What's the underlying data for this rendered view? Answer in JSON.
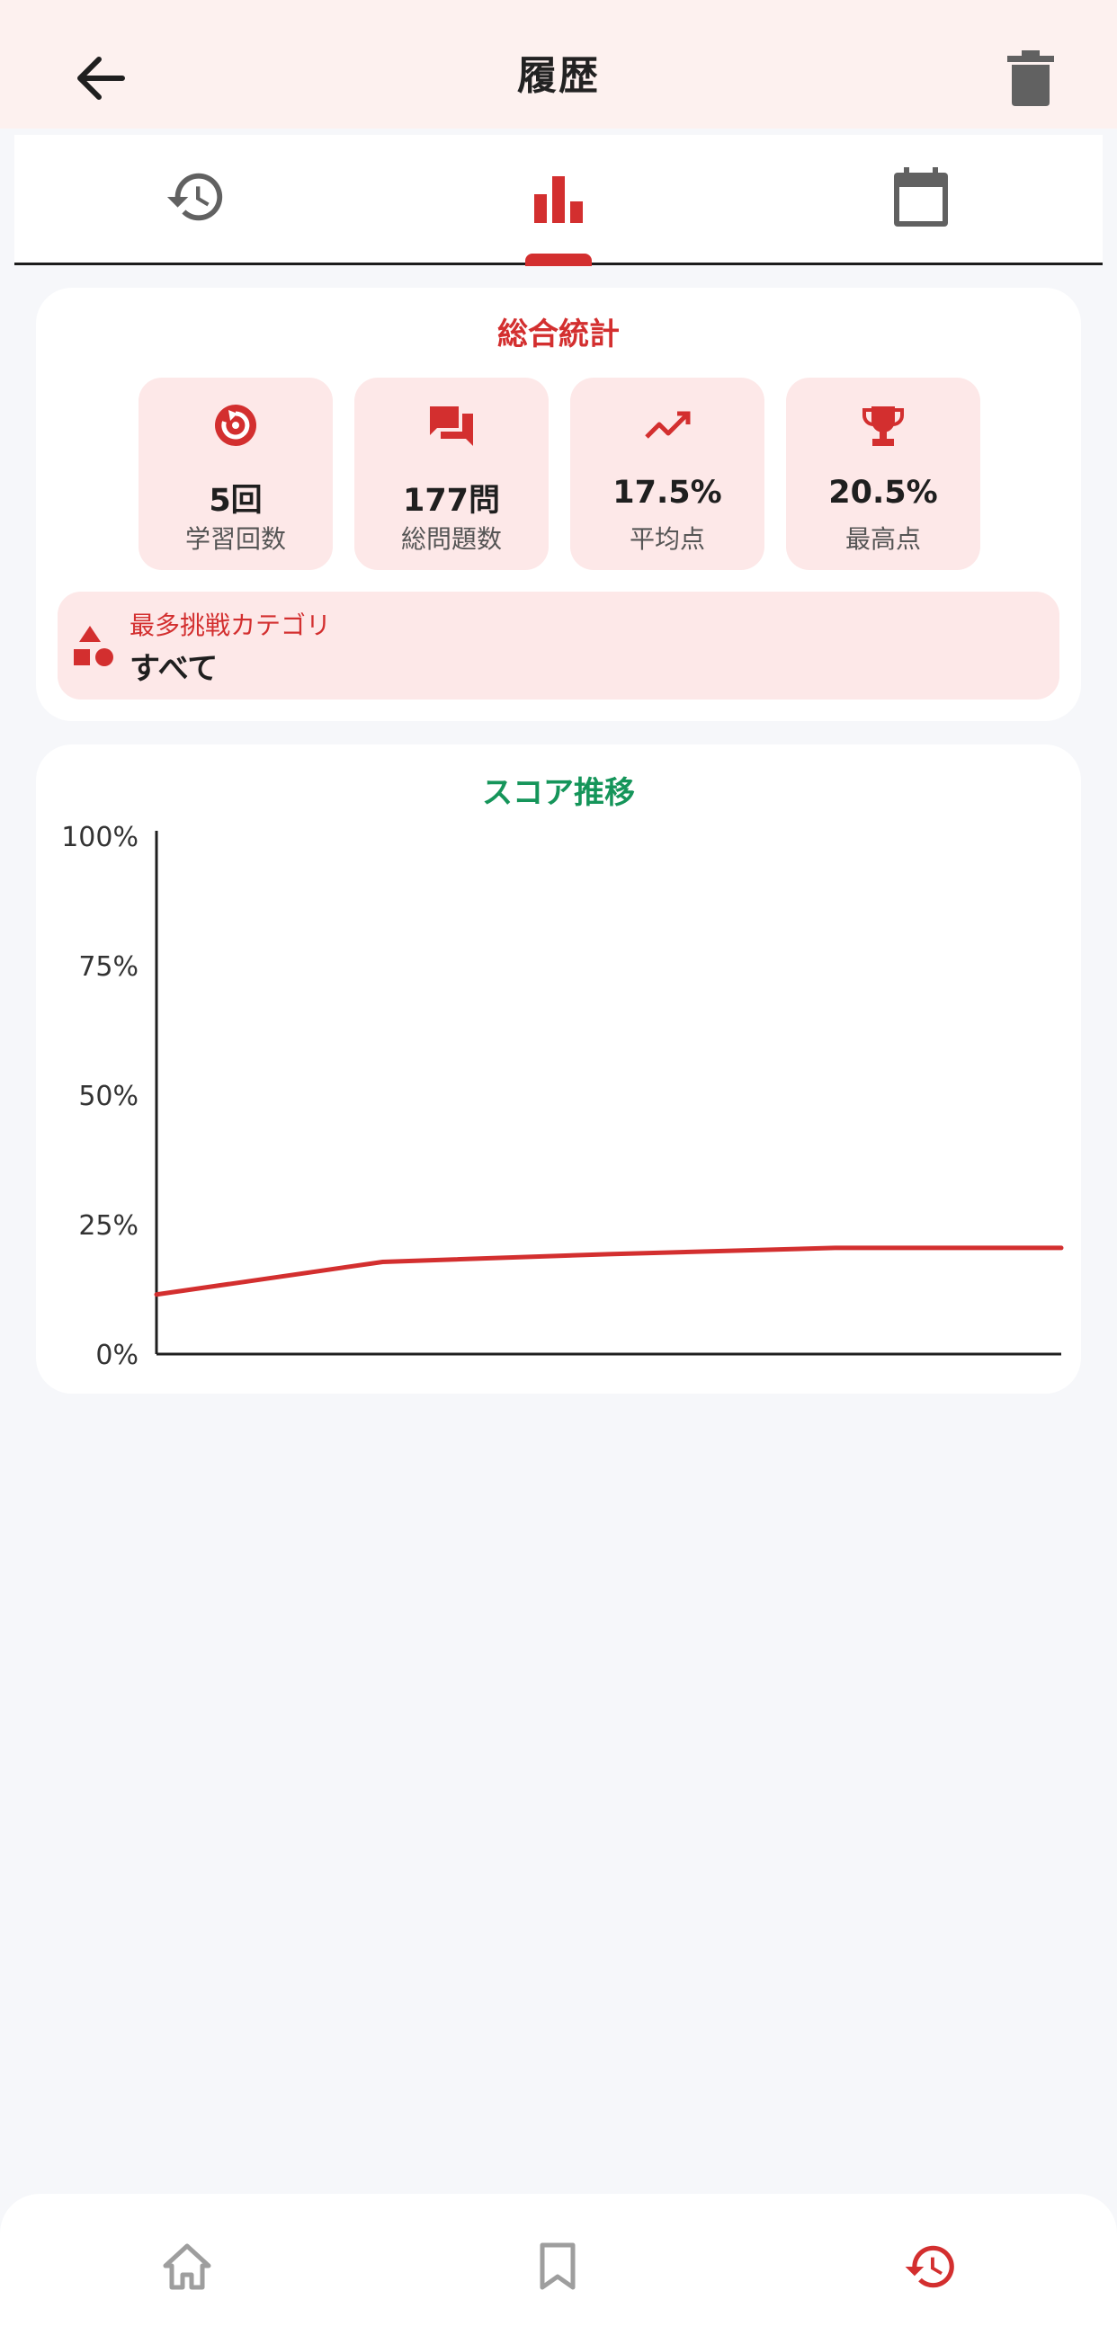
{
  "appbar": {
    "title": "履歴",
    "back_icon": "arrow-back-icon",
    "delete_icon": "trash-icon"
  },
  "tabs": [
    {
      "icon": "history-icon",
      "active": false
    },
    {
      "icon": "bar-chart-icon",
      "active": true
    },
    {
      "icon": "calendar-icon",
      "active": false
    }
  ],
  "stats": {
    "title": "総合統計",
    "items": [
      {
        "icon": "replay-icon",
        "value": "5回",
        "label": "学習回数"
      },
      {
        "icon": "chat-icon",
        "value": "177問",
        "label": "総問題数"
      },
      {
        "icon": "trending-up-icon",
        "value": "17.5%",
        "label": "平均点"
      },
      {
        "icon": "trophy-icon",
        "value": "20.5%",
        "label": "最高点"
      }
    ],
    "category": {
      "icon": "category-shapes-icon",
      "label": "最多挑戦カテゴリ",
      "value": "すべて"
    }
  },
  "chart_title": "スコア推移",
  "chart_data": {
    "type": "line",
    "x": [
      1,
      2,
      3,
      4,
      5
    ],
    "series": [
      {
        "values": [
          11.5,
          17.8,
          19.3,
          20.5,
          20.5
        ]
      }
    ],
    "ylim": [
      0,
      100
    ],
    "yticks": [
      "0%",
      "25%",
      "50%",
      "75%",
      "100%"
    ],
    "ytick_values": [
      0,
      25,
      50,
      75,
      100
    ],
    "grid": false,
    "line_color": "#d32f2f"
  },
  "bottom_nav": [
    {
      "icon": "home-icon",
      "active": false
    },
    {
      "icon": "bookmark-icon",
      "active": false
    },
    {
      "icon": "history-icon",
      "active": true
    }
  ],
  "colors": {
    "accent": "#d32f2f",
    "chart_title": "#15955a",
    "stat_bg": "#fde8e8",
    "appbar_bg": "#fdf1ef"
  }
}
